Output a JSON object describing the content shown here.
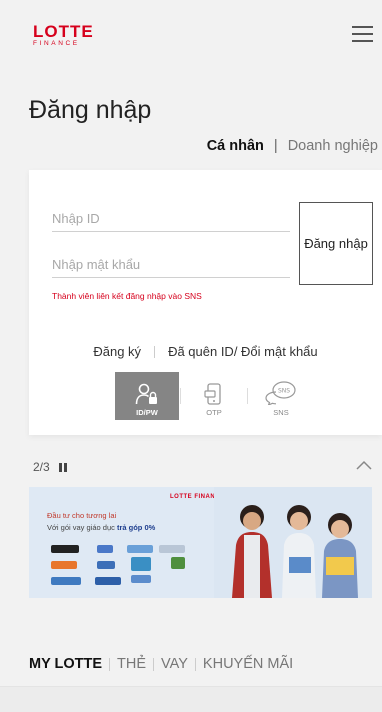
{
  "header": {
    "logo_main": "LOTTE",
    "logo_sub": "FINANCE"
  },
  "page": {
    "title": "Đăng nhập"
  },
  "account_type": {
    "personal": "Cá nhân",
    "separator": "|",
    "business": "Doanh nghiệp"
  },
  "login": {
    "id_placeholder": "Nhập ID",
    "password_placeholder": "Nhập mật khẩu",
    "submit_label": "Đăng nhập",
    "sns_note": "Thành viên liên kết đăng nhập vào SNS",
    "register_link": "Đăng ký",
    "forgot_link": "Đã quên ID/ Đổi mật khẩu",
    "methods": [
      {
        "label": "ID/PW",
        "icon": "user-lock-icon",
        "active": true
      },
      {
        "label": "OTP",
        "icon": "otp-phone-icon",
        "active": false
      },
      {
        "label": "SNS",
        "icon": "sns-chat-icon",
        "active": false
      }
    ]
  },
  "slider": {
    "position": "2/3"
  },
  "banner": {
    "brand": "LOTTE FINANCE",
    "line1": "Đầu tư cho tương lai",
    "line2_prefix": "Với gói vay giáo dục ",
    "line2_emphasis": "trả góp 0%"
  },
  "bottom_nav": {
    "items": [
      "MY LOTTE",
      "THẺ",
      "VAY",
      "KHUYẾN MÃI"
    ]
  },
  "colors": {
    "brand_red": "#d6001c",
    "active_method": "#858585",
    "banner_bg": "#dfe9f4"
  }
}
